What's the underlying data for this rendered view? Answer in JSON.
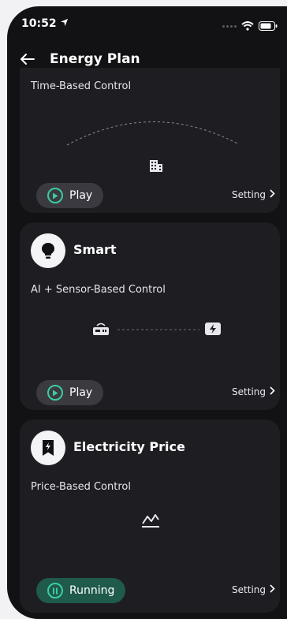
{
  "status": {
    "time": "10:52"
  },
  "header": {
    "title": "Energy Plan"
  },
  "plans": [
    {
      "subtitle": "Time-Based Control",
      "action_label": "Play",
      "setting_label": "Setting"
    },
    {
      "name": "Smart",
      "subtitle": "AI + Sensor-Based Control",
      "action_label": "Play",
      "setting_label": "Setting"
    },
    {
      "name": "Electricity Price",
      "subtitle": "Price-Based Control",
      "action_label": "Running",
      "setting_label": "Setting"
    }
  ],
  "colors": {
    "background": "#121214",
    "card": "#1e1d22",
    "accent": "#3ccca5",
    "running_bg": "#1f5a4c"
  },
  "icons": [
    "back-arrow-icon",
    "location-arrow-icon",
    "signal-dots-icon",
    "wifi-icon",
    "battery-icon",
    "building-icon",
    "bulb-icon",
    "router-icon",
    "charger-icon",
    "price-tag-icon",
    "price-chart-icon",
    "play-icon",
    "pause-icon",
    "chevron-right-icon"
  ]
}
